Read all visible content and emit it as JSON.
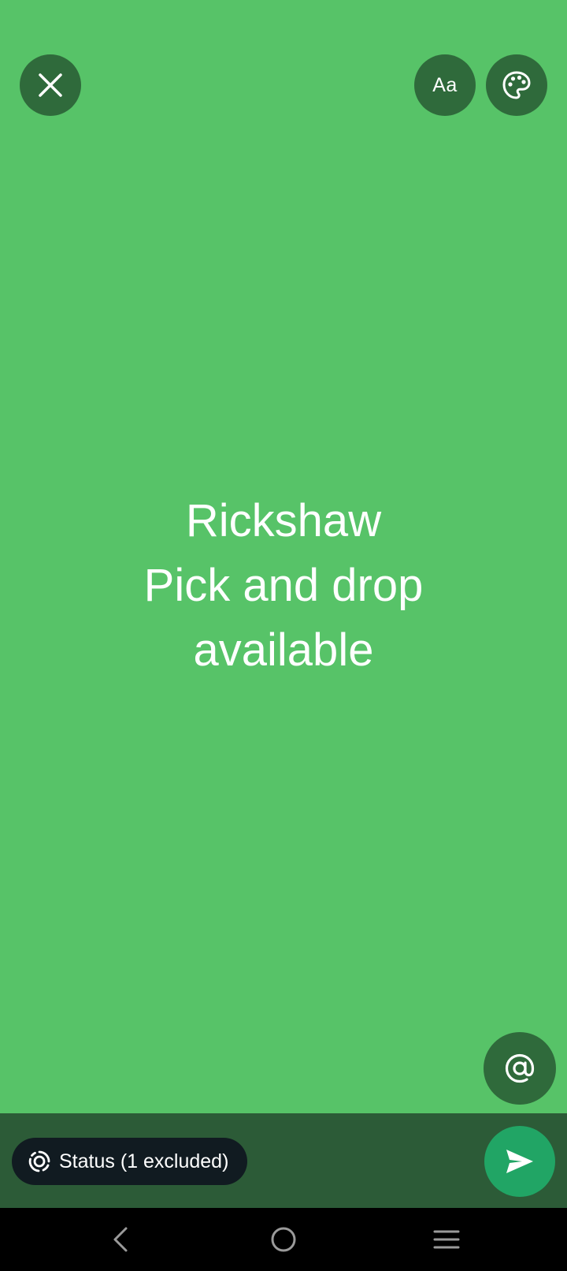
{
  "toolbar": {
    "close_icon": "close-icon",
    "font_label": "Aa",
    "palette_icon": "palette-icon"
  },
  "status": {
    "lines": [
      "Rickshaw",
      "Pick and drop",
      "available"
    ]
  },
  "mention": {
    "icon": "at-sign-icon"
  },
  "composer": {
    "audience_label": "Status (1 excluded)",
    "audience_icon": "status-ring-icon",
    "send_icon": "send-icon"
  },
  "system_nav": {
    "back_icon": "back-icon",
    "home_icon": "home-icon",
    "recents_icon": "recents-icon"
  },
  "colors": {
    "background": "#57c368",
    "button_dark": "#2f6a3b",
    "bottom_bar": "#2c5b37",
    "chip": "#111b21",
    "send": "#21a565",
    "nav": "#000000"
  }
}
